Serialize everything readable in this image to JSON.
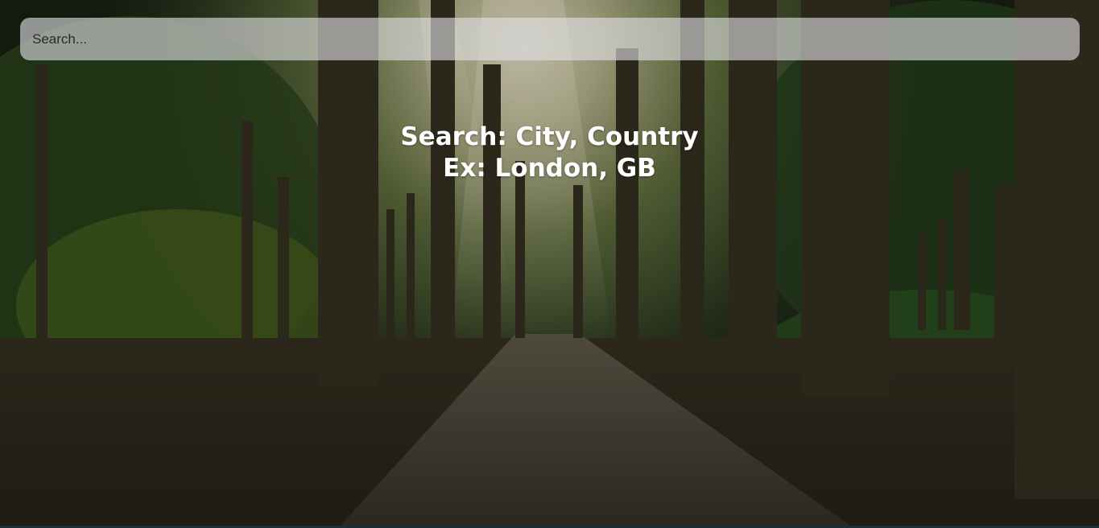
{
  "search": {
    "placeholder": "Search..."
  },
  "hint": {
    "line1": "Search: City, Country",
    "line2": "Ex: London, GB"
  },
  "background": {
    "image": "forest-path-photo"
  }
}
